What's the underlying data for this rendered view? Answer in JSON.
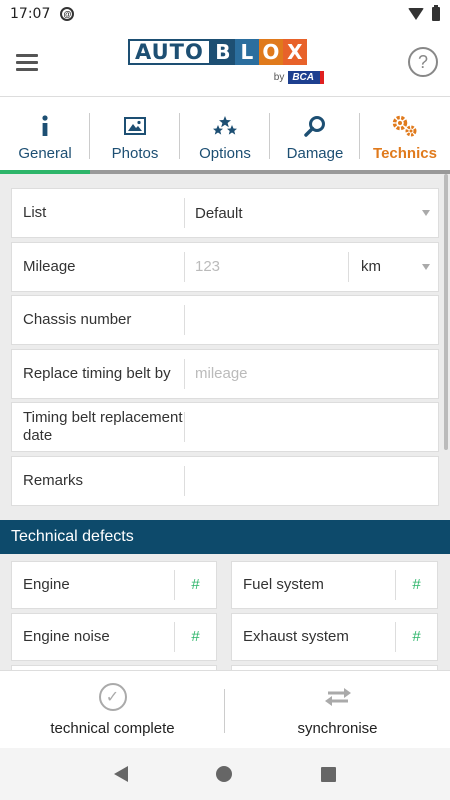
{
  "status": {
    "time": "17:07"
  },
  "header": {
    "logo_auto": "AUTO",
    "logo_letters": [
      {
        "char": "B",
        "color": "#1d4f73"
      },
      {
        "char": "L",
        "color": "#2b6e9e"
      },
      {
        "char": "O",
        "color": "#e07a1c"
      },
      {
        "char": "X",
        "color": "#e8622a"
      }
    ],
    "logo_by": "by",
    "logo_bca": "BCA",
    "help_symbol": "?"
  },
  "tabs": [
    {
      "label": "General",
      "icon": "info-icon"
    },
    {
      "label": "Photos",
      "icon": "photo-icon"
    },
    {
      "label": "Options",
      "icon": "stars-icon"
    },
    {
      "label": "Damage",
      "icon": "search-icon"
    },
    {
      "label": "Technics",
      "icon": "gears-icon"
    }
  ],
  "form": {
    "list": {
      "label": "List",
      "value": "Default"
    },
    "mileage": {
      "label": "Mileage",
      "placeholder": "123",
      "unit": "km"
    },
    "chassis": {
      "label": "Chassis number",
      "value": ""
    },
    "timing_belt": {
      "label": "Replace timing belt by",
      "placeholder": "mileage"
    },
    "timing_date": {
      "label": "Timing belt replacement date",
      "value": ""
    },
    "remarks": {
      "label": "Remarks",
      "value": ""
    }
  },
  "defects": {
    "title": "Technical defects",
    "items": [
      {
        "label": "Engine",
        "badge": "#"
      },
      {
        "label": "Fuel system",
        "badge": "#"
      },
      {
        "label": "Engine noise",
        "badge": "#"
      },
      {
        "label": "Exhaust system",
        "badge": "#"
      }
    ]
  },
  "actions": {
    "complete": "technical complete",
    "sync": "synchronise"
  },
  "colors": {
    "accent_green": "#2db56a",
    "accent_orange": "#e07a1c",
    "brand_blue": "#0d4a6b"
  }
}
